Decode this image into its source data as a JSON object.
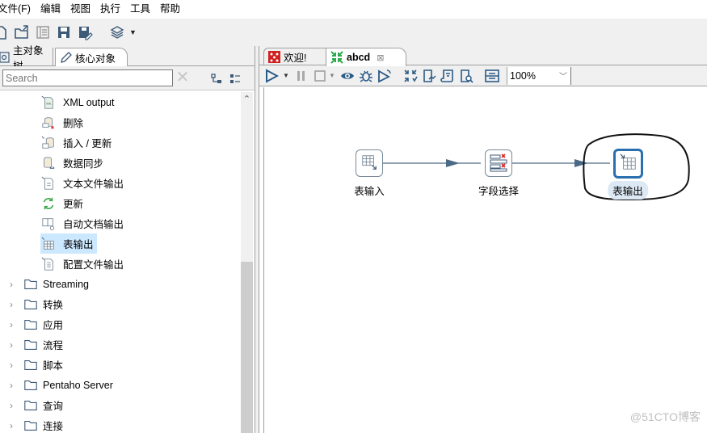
{
  "menu": [
    "文件(F)",
    "编辑",
    "视图",
    "执行",
    "工具",
    "帮助"
  ],
  "left_panel": {
    "tabs": [
      {
        "label": "主对象树",
        "icon": "tree-search-icon"
      },
      {
        "label": "核心对象",
        "icon": "pencil-icon"
      }
    ],
    "search_placeholder": "Search",
    "steps": [
      {
        "label": "XML output",
        "icon": "xml-output-icon"
      },
      {
        "label": "删除",
        "icon": "delete-db-icon"
      },
      {
        "label": "插入 / 更新",
        "icon": "insert-update-icon"
      },
      {
        "label": "数据同步",
        "icon": "data-sync-icon"
      },
      {
        "label": "文本文件输出",
        "icon": "text-file-output-icon"
      },
      {
        "label": "更新",
        "icon": "update-icon"
      },
      {
        "label": "自动文档输出",
        "icon": "auto-doc-output-icon"
      },
      {
        "label": "表输出",
        "icon": "table-output-icon",
        "selected": true
      },
      {
        "label": "配置文件输出",
        "icon": "properties-output-icon"
      }
    ],
    "folders": [
      "Streaming",
      "转换",
      "应用",
      "流程",
      "脚本",
      "Pentaho Server",
      "查询",
      "连接"
    ]
  },
  "editor": {
    "tabs": [
      {
        "label": "欢迎!",
        "icon": "welcome-icon"
      },
      {
        "label": "abcd",
        "icon": "transformation-icon",
        "active": true
      }
    ],
    "zoom": "100%",
    "nodes": [
      {
        "label": "表输入",
        "icon": "table-input-icon"
      },
      {
        "label": "字段选择",
        "icon": "select-values-icon"
      },
      {
        "label": "表输出",
        "icon": "table-output-icon",
        "selected": true
      }
    ]
  },
  "watermark": "@51CTO博客",
  "colors": {
    "accent": "#2a6fb0",
    "hop": "#4a6a86",
    "selection": "#cce8ff"
  }
}
